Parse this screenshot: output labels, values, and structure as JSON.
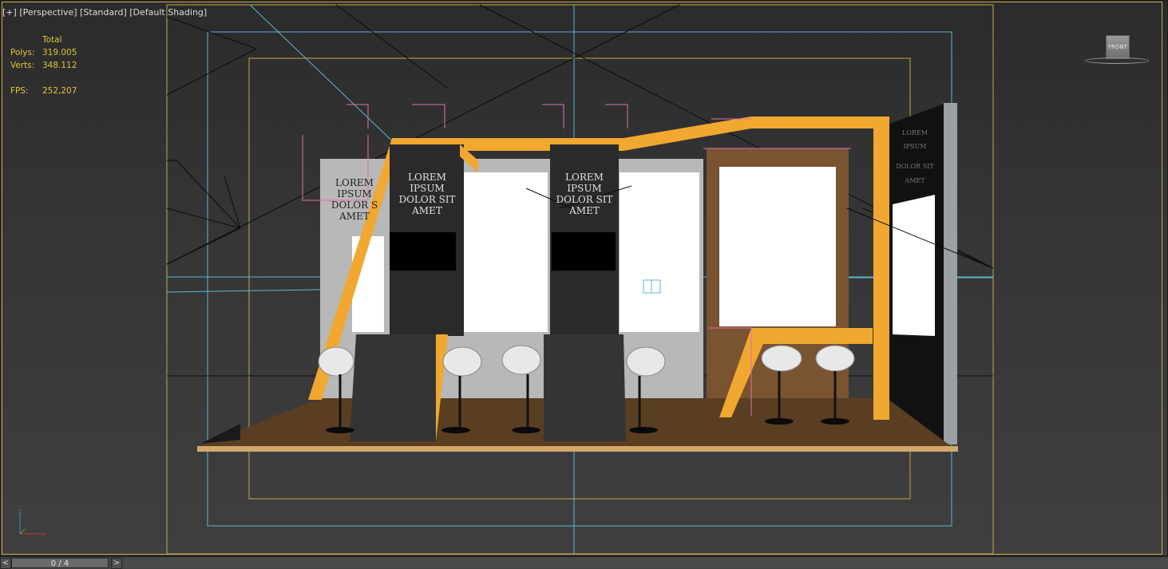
{
  "viewport": {
    "labels": [
      "[+]",
      "[Perspective]",
      "[Standard]",
      "[Default Shading]"
    ],
    "stats": {
      "header": "Total",
      "polys_label": "Polys:",
      "polys_value": "319.005",
      "verts_label": "Verts:",
      "verts_value": "348.112",
      "fps_label": "FPS:",
      "fps_value": "252,207"
    },
    "signage": {
      "left_wall_lines": [
        "LOREM",
        "IPSUM",
        "DOLOR S",
        "AMET"
      ],
      "column1_lines": [
        "LOREM",
        "IPSUM",
        "DOLOR SIT",
        "AMET"
      ],
      "column2_lines": [
        "LOREM",
        "IPSUM",
        "DOLOR SIT",
        "AMET"
      ],
      "right_wall_lines": [
        "LOREM",
        "IPSUM",
        "DOLOR SIT",
        "AMET"
      ]
    },
    "viewcube_face": "FRONT",
    "colors": {
      "accent_orange": "#f0a830",
      "safe_frame_yellow": "#c8a840",
      "safe_frame_cyan": "#5ab8d0",
      "stats_yellow": "#e2c43a",
      "helper_pink": "#e070b0",
      "floor_wood": "#5a3e22"
    }
  },
  "timeline": {
    "prev_label": "<",
    "next_label": ">",
    "frame_text": "0 / 4"
  }
}
